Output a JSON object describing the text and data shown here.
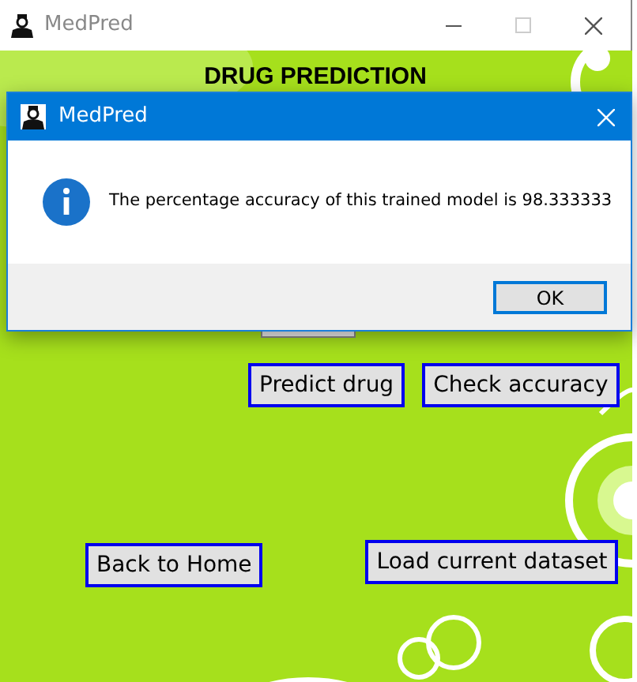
{
  "window": {
    "title": "MedPred"
  },
  "heading": "DRUG PREDICTION",
  "buttons": [
    {
      "label": "Predict drug"
    },
    {
      "label": "Check accuracy"
    },
    {
      "label": "Back to Home"
    },
    {
      "label": "Load current dataset"
    }
  ],
  "dialog": {
    "title": "MedPred",
    "message": "The percentage accuracy of this trained model is 98.333333",
    "button": "OK"
  }
}
